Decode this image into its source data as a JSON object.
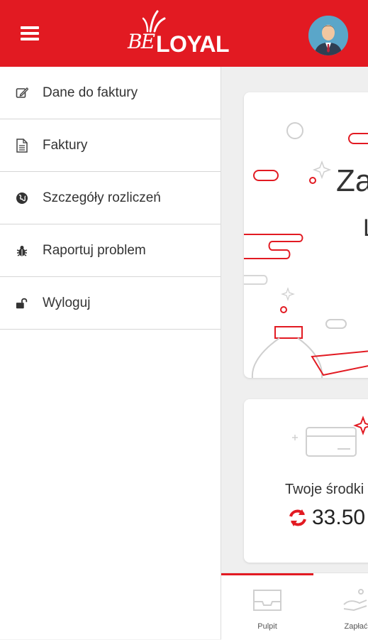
{
  "header": {
    "brand_be": "BE",
    "brand_loyal": "LOYAL",
    "accent": "#e21a22"
  },
  "menu": {
    "items": [
      {
        "label": "Dane do faktury",
        "icon": "edit-icon"
      },
      {
        "label": "Faktury",
        "icon": "document-icon"
      },
      {
        "label": "Szczegóły rozliczeń",
        "icon": "globe-icon"
      },
      {
        "label": "Raportuj problem",
        "icon": "bug-icon"
      },
      {
        "label": "Wyloguj",
        "icon": "unlock-icon"
      }
    ]
  },
  "main": {
    "greeting_partial": "Za",
    "greeting_line2_partial": "L",
    "funds_label": "Twoje środki",
    "funds_value": "33.50"
  },
  "bottom_nav": {
    "items": [
      {
        "label": "Pulpit",
        "icon": "inbox-icon",
        "active": true
      },
      {
        "label": "Zapłać",
        "icon": "pay-hand-icon",
        "active": false
      }
    ]
  }
}
